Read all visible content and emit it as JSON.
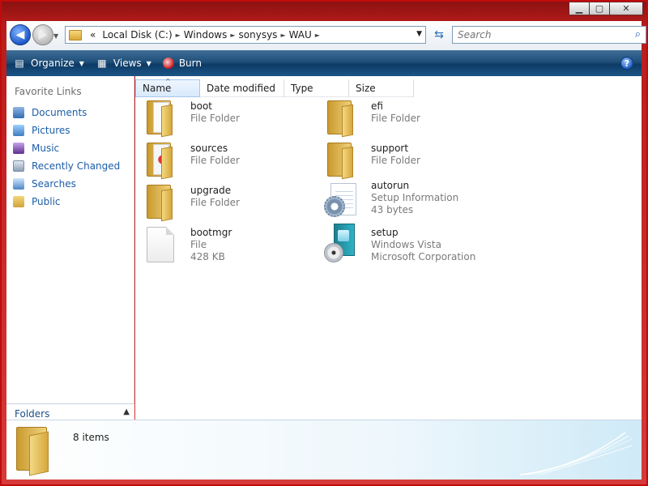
{
  "window": {
    "minimize": "▁",
    "maximize": "▢",
    "close": "✕"
  },
  "address": {
    "breadcrumb": [
      "«",
      "Local Disk (C:)",
      "Windows",
      "sonysys",
      "WAU"
    ],
    "separator": "►",
    "search_placeholder": "Search"
  },
  "toolbar": {
    "organize": "Organize",
    "views": "Views",
    "burn": "Burn",
    "help": "?"
  },
  "navpane": {
    "title": "Favorite Links",
    "items": [
      {
        "label": "Documents",
        "icon": "documents-icon"
      },
      {
        "label": "Pictures",
        "icon": "pictures-icon"
      },
      {
        "label": "Music",
        "icon": "music-icon"
      },
      {
        "label": "Recently Changed",
        "icon": "recent-icon"
      },
      {
        "label": "Searches",
        "icon": "searches-icon"
      },
      {
        "label": "Public",
        "icon": "public-folder-icon"
      }
    ],
    "folders_label": "Folders"
  },
  "columns": [
    "Name",
    "Date modified",
    "Type",
    "Size"
  ],
  "files": [
    {
      "name": "boot",
      "line2": "File Folder",
      "line3": "",
      "icon": "folder-icon"
    },
    {
      "name": "efi",
      "line2": "File Folder",
      "line3": "",
      "icon": "folder-icon"
    },
    {
      "name": "sources",
      "line2": "File Folder",
      "line3": "",
      "icon": "folder-icon"
    },
    {
      "name": "support",
      "line2": "File Folder",
      "line3": "",
      "icon": "folder-icon"
    },
    {
      "name": "upgrade",
      "line2": "File Folder",
      "line3": "",
      "icon": "folder-icon"
    },
    {
      "name": "autorun",
      "line2": "Setup Information",
      "line3": "43 bytes",
      "icon": "setup-information-icon"
    },
    {
      "name": "bootmgr",
      "line2": "File",
      "line3": "428 KB",
      "icon": "file-icon"
    },
    {
      "name": "setup",
      "line2": "Windows Vista",
      "line3": "Microsoft Corporation",
      "icon": "setup-exe-icon"
    }
  ],
  "details": {
    "count": "8 items"
  },
  "colors": {
    "frame": "#c10b0b",
    "toolbar": "#1f4f79",
    "link": "#1c5da8"
  }
}
